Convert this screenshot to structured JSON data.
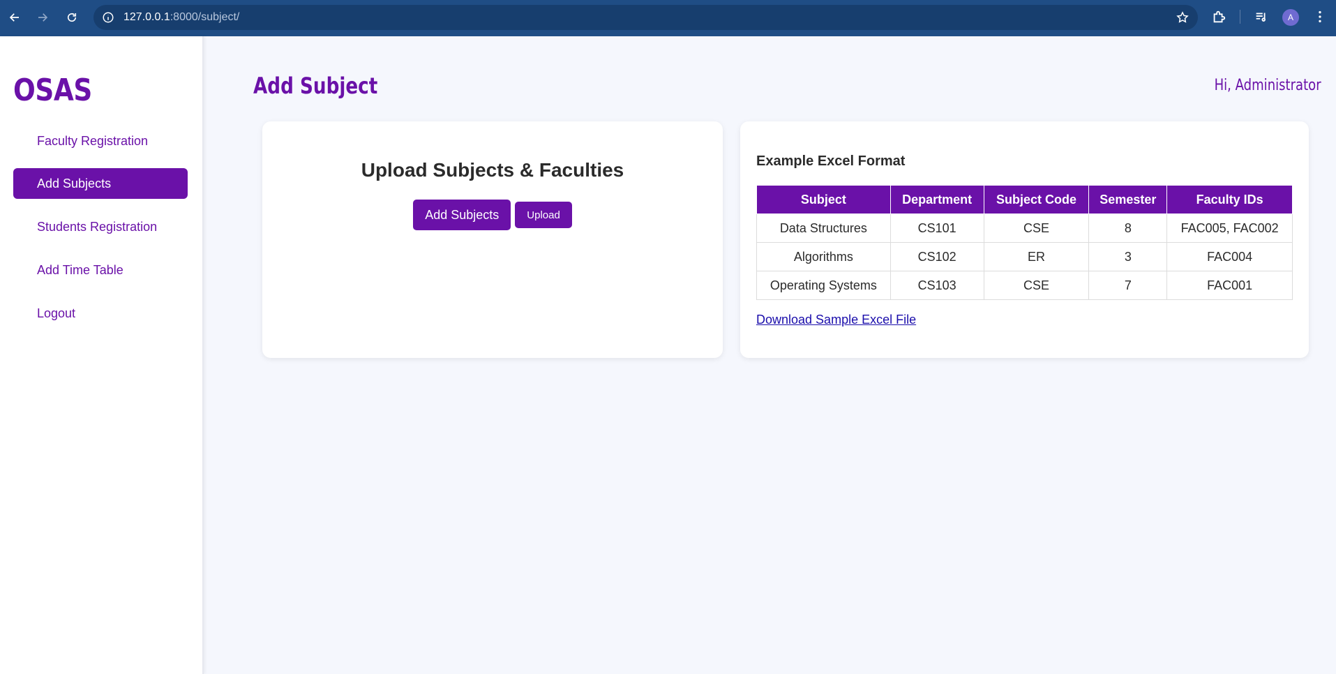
{
  "browser": {
    "url_host": "127.0.0.1",
    "url_path": ":8000/subject/",
    "profile_initial": "A"
  },
  "sidebar": {
    "logo": "OSAS",
    "items": [
      {
        "label": "Faculty Registration"
      },
      {
        "label": "Add Subjects"
      },
      {
        "label": "Students Registration"
      },
      {
        "label": "Add Time Table"
      },
      {
        "label": "Logout"
      }
    ],
    "active_index": 1
  },
  "header": {
    "title": "Add Subject",
    "greeting": "Hi, Administrator"
  },
  "upload_card": {
    "title": "Upload Subjects & Faculties",
    "add_button": "Add Subjects",
    "upload_button": "Upload"
  },
  "example_card": {
    "title": "Example Excel Format",
    "columns": [
      "Subject",
      "Department",
      "Subject Code",
      "Semester",
      "Faculty IDs"
    ],
    "rows": [
      [
        "Data Structures",
        "CS101",
        "CSE",
        "8",
        "FAC005, FAC002"
      ],
      [
        "Algorithms",
        "CS102",
        "ER",
        "3",
        "FAC004"
      ],
      [
        "Operating Systems",
        "CS103",
        "CSE",
        "7",
        "FAC001"
      ]
    ],
    "download_link": "Download Sample Excel File"
  },
  "colors": {
    "accent": "#6a11a8",
    "chrome": "#1f4d85",
    "background": "#f5f7fd"
  }
}
